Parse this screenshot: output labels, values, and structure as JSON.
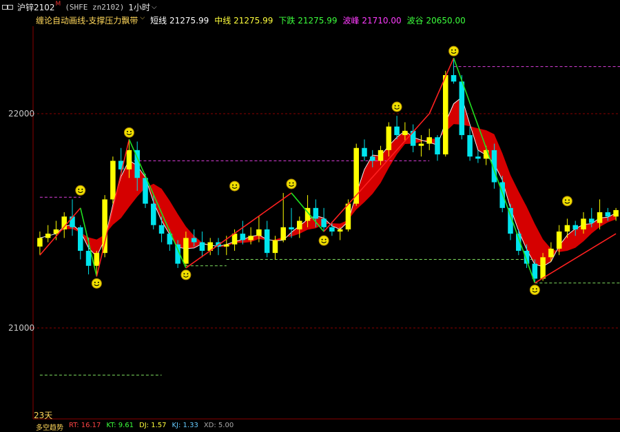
{
  "header": {
    "symbol": "沪锌2102",
    "superscript": "M",
    "code": "(SHFE zn2102)",
    "period": "1小时",
    "chevron": "⌵"
  },
  "indicator": {
    "name": "缠论自动画线-支撑压力飘带",
    "items": [
      {
        "label": "短线",
        "value": "21275.99"
      },
      {
        "label": "中线",
        "value": "21275.99"
      },
      {
        "label": "下跌",
        "value": "21275.99"
      },
      {
        "label": "波峰",
        "value": "21710.00"
      },
      {
        "label": "波谷",
        "value": "20650.00"
      }
    ]
  },
  "axis": {
    "labels": [
      "22000",
      "21000"
    ],
    "days_label": "23天"
  },
  "bottom_row": {
    "title": "多空趋势",
    "items": [
      "RT: 16.17",
      "KT: 9.61",
      "DJ: 1.57",
      "KJ: 1.33",
      "XD: 5.00"
    ]
  },
  "colors": {
    "up": "#ffff00",
    "down": "#00e5ee",
    "ribbon": "#e00000",
    "zigzag_red": "#ff2020",
    "zigzag_green": "#20e020",
    "resistance": "#e040e0",
    "support": "#80e060",
    "grid": "#8b0000",
    "smiley": "#f0e000"
  },
  "chart_data": {
    "type": "candlestick",
    "y_ticks": [
      22000,
      21000
    ],
    "ylim": [
      20740,
      22400
    ],
    "bars": [
      [
        21380,
        21450,
        21340,
        21420
      ],
      [
        21420,
        21480,
        21400,
        21440
      ],
      [
        21440,
        21500,
        21410,
        21460
      ],
      [
        21460,
        21540,
        21420,
        21520
      ],
      [
        21520,
        21600,
        21430,
        21470
      ],
      [
        21470,
        21480,
        21320,
        21360
      ],
      [
        21360,
        21420,
        21250,
        21290
      ],
      [
        21290,
        21360,
        21240,
        21350
      ],
      [
        21350,
        21620,
        21330,
        21600
      ],
      [
        21600,
        21800,
        21580,
        21780
      ],
      [
        21780,
        21840,
        21720,
        21740
      ],
      [
        21740,
        21880,
        21700,
        21830
      ],
      [
        21830,
        21870,
        21640,
        21700
      ],
      [
        21700,
        21720,
        21560,
        21580
      ],
      [
        21580,
        21620,
        21460,
        21480
      ],
      [
        21480,
        21520,
        21400,
        21440
      ],
      [
        21440,
        21460,
        21360,
        21390
      ],
      [
        21390,
        21410,
        21280,
        21300
      ],
      [
        21300,
        21450,
        21290,
        21420
      ],
      [
        21420,
        21460,
        21380,
        21400
      ],
      [
        21400,
        21450,
        21330,
        21360
      ],
      [
        21360,
        21420,
        21340,
        21400
      ],
      [
        21400,
        21420,
        21340,
        21380
      ],
      [
        21380,
        21430,
        21340,
        21390
      ],
      [
        21390,
        21460,
        21360,
        21440
      ],
      [
        21440,
        21500,
        21390,
        21410
      ],
      [
        21410,
        21470,
        21390,
        21430
      ],
      [
        21430,
        21520,
        21400,
        21460
      ],
      [
        21460,
        21500,
        21330,
        21350
      ],
      [
        21350,
        21430,
        21320,
        21410
      ],
      [
        21410,
        21630,
        21400,
        21470
      ],
      [
        21470,
        21560,
        21420,
        21460
      ],
      [
        21460,
        21520,
        21420,
        21500
      ],
      [
        21500,
        21620,
        21470,
        21560
      ],
      [
        21560,
        21600,
        21470,
        21510
      ],
      [
        21510,
        21560,
        21450,
        21470
      ],
      [
        21470,
        21490,
        21430,
        21450
      ],
      [
        21450,
        21470,
        21410,
        21460
      ],
      [
        21460,
        21600,
        21450,
        21580
      ],
      [
        21580,
        21860,
        21570,
        21840
      ],
      [
        21840,
        21880,
        21780,
        21800
      ],
      [
        21800,
        21830,
        21750,
        21780
      ],
      [
        21780,
        21850,
        21760,
        21830
      ],
      [
        21830,
        21960,
        21800,
        21940
      ],
      [
        21940,
        21990,
        21880,
        21900
      ],
      [
        21900,
        21960,
        21870,
        21920
      ],
      [
        21920,
        21950,
        21820,
        21850
      ],
      [
        21850,
        21900,
        21800,
        21860
      ],
      [
        21860,
        21930,
        21830,
        21890
      ],
      [
        21890,
        21900,
        21780,
        21810
      ],
      [
        21810,
        22200,
        21800,
        22180
      ],
      [
        22180,
        22260,
        22140,
        22150
      ],
      [
        22150,
        22180,
        21880,
        21900
      ],
      [
        21900,
        21940,
        21780,
        21800
      ],
      [
        21800,
        21830,
        21770,
        21790
      ],
      [
        21790,
        21850,
        21760,
        21830
      ],
      [
        21830,
        21860,
        21650,
        21680
      ],
      [
        21680,
        21710,
        21540,
        21560
      ],
      [
        21560,
        21580,
        21410,
        21440
      ],
      [
        21440,
        21460,
        21340,
        21360
      ],
      [
        21360,
        21390,
        21280,
        21300
      ],
      [
        21300,
        21320,
        21210,
        21230
      ],
      [
        21230,
        21350,
        21220,
        21330
      ],
      [
        21330,
        21400,
        21310,
        21370
      ],
      [
        21370,
        21480,
        21340,
        21450
      ],
      [
        21450,
        21510,
        21420,
        21480
      ],
      [
        21480,
        21500,
        21430,
        21460
      ],
      [
        21460,
        21540,
        21440,
        21510
      ],
      [
        21510,
        21560,
        21470,
        21490
      ],
      [
        21490,
        21600,
        21460,
        21540
      ],
      [
        21540,
        21560,
        21500,
        21520
      ],
      [
        21520,
        21560,
        21500,
        21550
      ]
    ],
    "zigzag": [
      {
        "i": 0,
        "v": 21340
      },
      {
        "i": 5,
        "v": 21560
      },
      {
        "i": 7,
        "v": 21240
      },
      {
        "i": 11,
        "v": 21880
      },
      {
        "i": 18,
        "v": 21280
      },
      {
        "i": 31,
        "v": 21630
      },
      {
        "i": 35,
        "v": 21450
      },
      {
        "i": 48,
        "v": 22000
      },
      {
        "i": 51,
        "v": 22260
      },
      {
        "i": 61,
        "v": 21210
      },
      {
        "i": 71,
        "v": 21440
      }
    ],
    "levels": [
      {
        "kind": "resistance",
        "value": 21780,
        "from": 11,
        "to": 48
      },
      {
        "kind": "resistance",
        "value": 21610,
        "from": 0,
        "to": 5
      },
      {
        "kind": "resistance",
        "value": 22220,
        "from": 51,
        "to": 72
      },
      {
        "kind": "support",
        "value": 21290,
        "from": 18,
        "to": 23
      },
      {
        "kind": "support",
        "value": 21320,
        "from": 23,
        "to": 61
      },
      {
        "kind": "support",
        "value": 21210,
        "from": 61,
        "to": 72
      },
      {
        "kind": "support",
        "value": 20780,
        "from": 0,
        "to": 15
      }
    ],
    "smileys": [
      {
        "i": 5,
        "v": 21610,
        "pos": "top"
      },
      {
        "i": 7,
        "v": 21240,
        "pos": "bottom"
      },
      {
        "i": 11,
        "v": 21880,
        "pos": "top"
      },
      {
        "i": 18,
        "v": 21280,
        "pos": "bottom"
      },
      {
        "i": 24,
        "v": 21630,
        "pos": "top"
      },
      {
        "i": 31,
        "v": 21640,
        "pos": "top"
      },
      {
        "i": 35,
        "v": 21440,
        "pos": "bottom"
      },
      {
        "i": 44,
        "v": 22000,
        "pos": "top"
      },
      {
        "i": 51,
        "v": 22260,
        "pos": "top"
      },
      {
        "i": 61,
        "v": 21210,
        "pos": "bottom"
      },
      {
        "i": 65,
        "v": 21560,
        "pos": "top"
      }
    ]
  }
}
